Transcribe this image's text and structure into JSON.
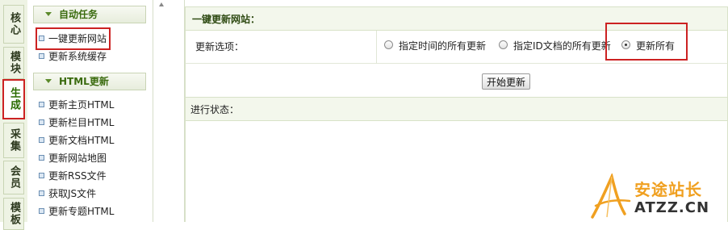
{
  "vtabs": [
    "核心",
    "模块",
    "生成",
    "采集",
    "会员",
    "模板"
  ],
  "sidebar": {
    "section1": "自动任务",
    "section1_items": [
      "一键更新网站",
      "更新系统缓存"
    ],
    "section2": "HTML更新",
    "section2_items": [
      "更新主页HTML",
      "更新栏目HTML",
      "更新文档HTML",
      "更新网站地图",
      "更新RSS文件",
      "获取JS文件",
      "更新专题HTML"
    ]
  },
  "main": {
    "title": "一键更新网站：",
    "options_label": "更新选项：",
    "options": [
      "指定时间的所有更新",
      "指定ID文档的所有更新",
      "更新所有"
    ],
    "start_button": "开始更新",
    "status_label": "进行状态："
  },
  "watermark": {
    "line1": "安途站长",
    "line2": "ATZZ.CN"
  },
  "colors": {
    "highlight": "#cc2222",
    "accent_green": "#3a6b0e",
    "watermark_orange": "#f0a020"
  }
}
